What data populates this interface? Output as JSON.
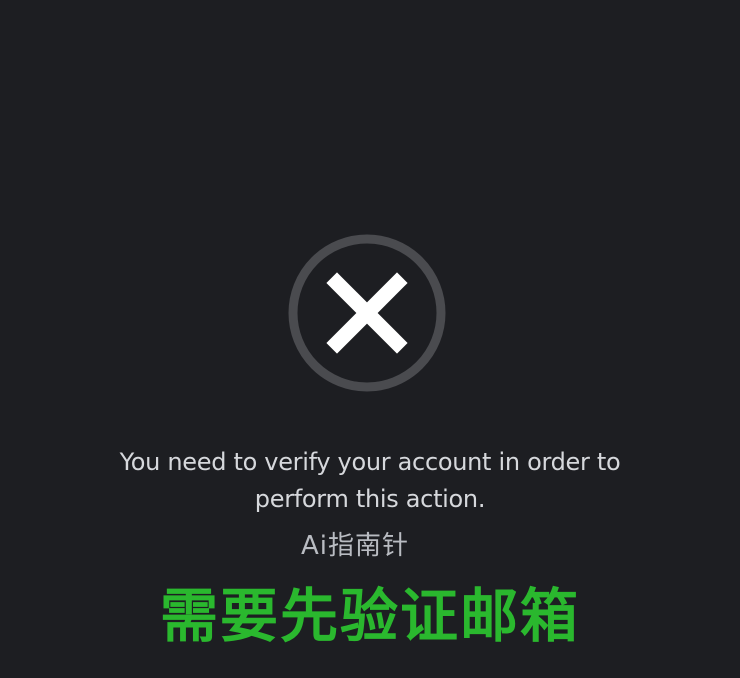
{
  "dialog": {
    "icon": "close-icon",
    "message_line1": "You need to verify your account in order to",
    "message_line2": "perform this action."
  },
  "overlay": {
    "watermark": "Ai指南针",
    "caption": "需要先验证邮箱"
  },
  "colors": {
    "background": "#1d1e22",
    "ring": "#4a4b4f",
    "icon": "#ffffff",
    "message_text": "#d6d8dc",
    "caption_text": "#2ab82e"
  }
}
